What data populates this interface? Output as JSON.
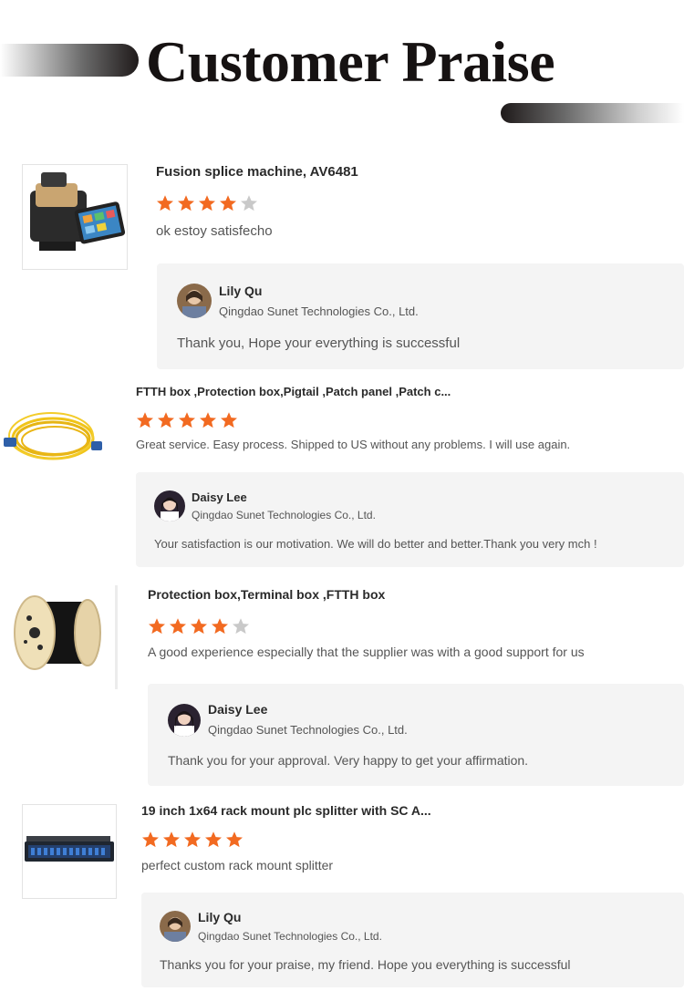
{
  "header": {
    "title": "Customer Praise"
  },
  "colors": {
    "star_filled": "#f26a21",
    "star_empty": "#c9c9c9",
    "reply_bg": "#f4f4f4"
  },
  "reviews": [
    {
      "product": "Fusion splice machine, AV6481",
      "rating": 4,
      "comment": "ok estoy satisfecho",
      "thumb_icon": "fusion-splicer-image",
      "reply": {
        "name": "Lily Qu",
        "company": "Qingdao Sunet Technologies Co., Ltd.",
        "text": "Thank you, Hope your everything is successful"
      }
    },
    {
      "product": "FTTH box ,Protection box,Pigtail ,Patch panel ,Patch c...",
      "rating": 5,
      "comment": "Great service.   Easy process.   Shipped to US without any problems.  I will use again.",
      "thumb_icon": "patch-cord-image",
      "reply": {
        "name": "Daisy Lee",
        "company": "Qingdao Sunet Technologies Co., Ltd.",
        "text": "Your satisfaction is our motivation. We will do better and better.Thank you very mch !"
      }
    },
    {
      "product": "Protection box,Terminal box ,FTTH box",
      "rating": 4,
      "comment": "A good experience especially that the supplier was with a good support for us",
      "thumb_icon": "cable-reel-image",
      "reply": {
        "name": "Daisy Lee",
        "company": "Qingdao Sunet Technologies Co., Ltd.",
        "text": "Thank you for your approval. Very happy to get your affirmation."
      }
    },
    {
      "product": "19 inch 1x64 rack mount plc splitter with SC A...",
      "rating": 5,
      "comment": "perfect custom rack mount splitter",
      "thumb_icon": "rack-splitter-image",
      "reply": {
        "name": "Lily Qu",
        "company": "Qingdao Sunet Technologies Co., Ltd.",
        "text": "Thanks you for your praise, my friend. Hope you everything is successful"
      }
    }
  ]
}
